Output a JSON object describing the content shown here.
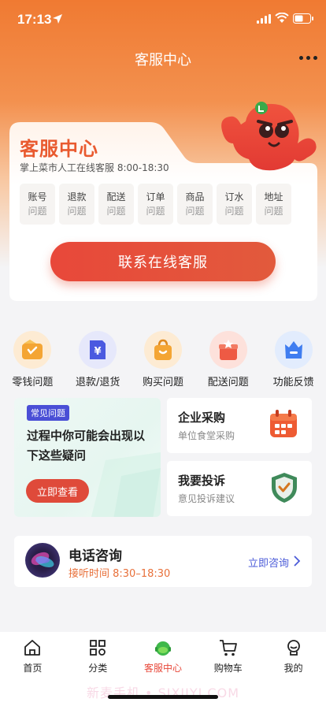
{
  "status_bar": {
    "time": "17:13"
  },
  "nav": {
    "title": "客服中心"
  },
  "hero": {
    "title": "客服中心",
    "subtitle": "掌上菜市人工在线客服  8:00-18:30",
    "chips": [
      {
        "label": "账号",
        "suffix": "问题"
      },
      {
        "label": "退款",
        "suffix": "问题"
      },
      {
        "label": "配送",
        "suffix": "问题"
      },
      {
        "label": "订单",
        "suffix": "问题"
      },
      {
        "label": "商品",
        "suffix": "问题"
      },
      {
        "label": "订水",
        "suffix": "问题"
      },
      {
        "label": "地址",
        "suffix": "问题"
      }
    ],
    "contact_button": "联系在线客服"
  },
  "quick_actions": [
    {
      "label": "零钱问题",
      "icon": "wallet-icon"
    },
    {
      "label": "退款/退货",
      "icon": "refund-icon"
    },
    {
      "label": "购买问题",
      "icon": "shopping-bag-icon"
    },
    {
      "label": "配送问题",
      "icon": "delivery-box-icon"
    },
    {
      "label": "功能反馈",
      "icon": "feedback-icon"
    }
  ],
  "faq": {
    "tag": "常见问题",
    "text": "过程中你可能会出现以下这些疑问",
    "button": "立即查看"
  },
  "enterprise": {
    "title": "企业采购",
    "subtitle": "单位食堂采购",
    "icon": "calendar-icon"
  },
  "complaint": {
    "title": "我要投诉",
    "subtitle": "意见投诉建议",
    "icon": "shield-check-icon"
  },
  "phone": {
    "title": "电话咨询",
    "hours": "接听时间 8:30–18:30",
    "link": "立即咨询"
  },
  "tab_bar": {
    "tabs": [
      {
        "label": "首页",
        "icon": "home-icon"
      },
      {
        "label": "分类",
        "icon": "category-icon"
      },
      {
        "label": "客服中心",
        "icon": "service-icon",
        "active": true
      },
      {
        "label": "购物车",
        "icon": "cart-icon"
      },
      {
        "label": "我的",
        "icon": "profile-icon"
      }
    ]
  },
  "watermark": "新麦手机 • SIXIIYI.COM",
  "colors": {
    "brand_orange": "#f07a32",
    "primary_red": "#e8483a",
    "link_blue": "#4b5bd8",
    "hours_orange": "#e8703a"
  }
}
